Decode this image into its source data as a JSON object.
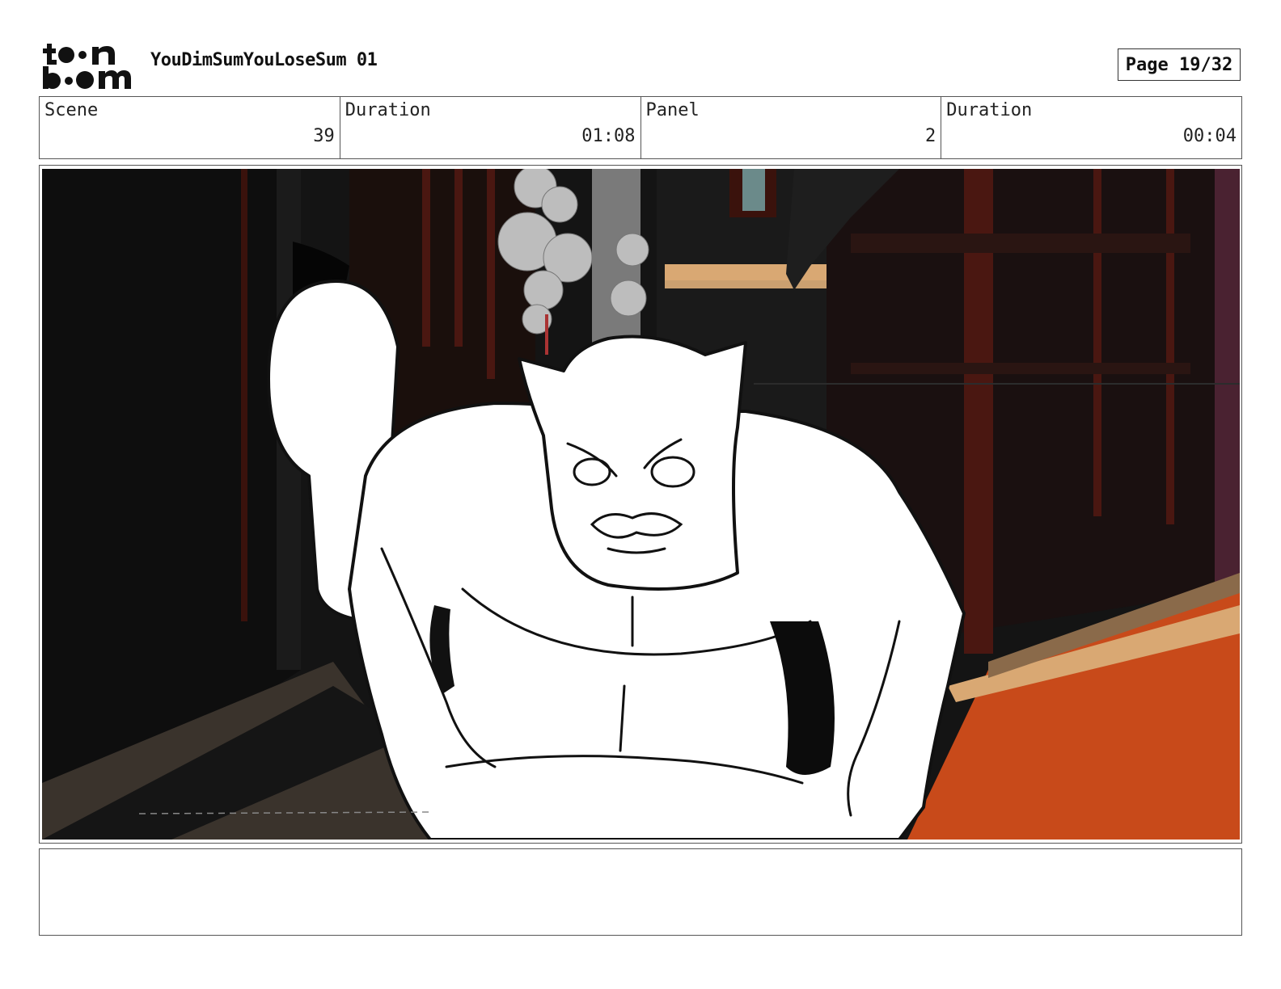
{
  "header": {
    "logo_text_top": "toon",
    "logo_text_bottom": "boom",
    "project_title": "YouDimSumYouLoseSum 01",
    "page_label": "Page 19/32"
  },
  "info": {
    "scene_label": "Scene",
    "scene_value": "39",
    "scene_duration_label": "Duration",
    "scene_duration_value": "01:08",
    "panel_label": "Panel",
    "panel_value": "2",
    "panel_duration_label": "Duration",
    "panel_duration_value": "00:04"
  },
  "panel": {
    "image_icon": "storyboard-frame-image"
  },
  "notes": {
    "text": ""
  },
  "colors": {
    "border": "#555555",
    "alley_dark": "#151515",
    "brick_red": "#5a1a12",
    "wall_orange": "#c84a1a",
    "trim_tan": "#d9a873",
    "purple_wall": "#4a2231"
  }
}
